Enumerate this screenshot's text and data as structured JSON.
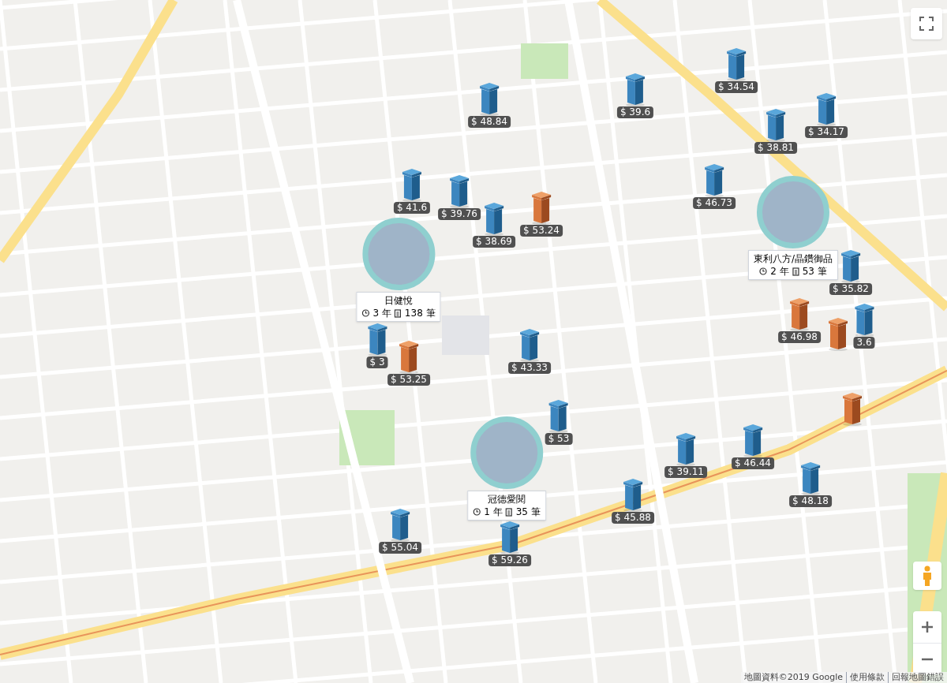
{
  "markers": [
    {
      "kind": "blue",
      "price": "$ 48.84"
    },
    {
      "kind": "blue",
      "price": "$ 39.6"
    },
    {
      "kind": "blue",
      "price": "$ 34.54"
    },
    {
      "kind": "blue",
      "price": "$ 38.81"
    },
    {
      "kind": "blue",
      "price": "$ 34.17"
    },
    {
      "kind": "blue",
      "price": "$ 41.6"
    },
    {
      "kind": "blue",
      "price": "$ 39.76"
    },
    {
      "kind": "blue",
      "price": "$ 38.69"
    },
    {
      "kind": "orange",
      "price": "$ 53.24"
    },
    {
      "kind": "blue",
      "price": "$ 46.73"
    },
    {
      "kind": "blue",
      "price": "$ 35.82"
    },
    {
      "kind": "orange",
      "price": "$ 46.98"
    },
    {
      "kind": "blue",
      "price": "3.6"
    },
    {
      "kind": "blue",
      "price": "$ 3"
    },
    {
      "kind": "orange",
      "price": "$ 53.25"
    },
    {
      "kind": "blue",
      "price": "$ 43.33"
    },
    {
      "kind": "blue",
      "price": "$ 53"
    },
    {
      "kind": "blue",
      "price": "$ 46.44"
    },
    {
      "kind": "blue",
      "price": "$ 39.11"
    },
    {
      "kind": "blue",
      "price": "$ 48.18"
    },
    {
      "kind": "blue",
      "price": "$ 45.88"
    },
    {
      "kind": "blue",
      "price": "$ 55.04"
    },
    {
      "kind": "blue",
      "price": "$ 59.26"
    },
    {
      "kind": "orange"
    },
    {
      "kind": "orange"
    }
  ],
  "projects": [
    {
      "name": "日健悅",
      "years": "3 年",
      "count": "138 筆"
    },
    {
      "name": "東利八方/晶鑽御品",
      "years": "2 年",
      "count": "53 筆"
    },
    {
      "name": "冠德愛閱",
      "years": "1 年",
      "count": "35 筆"
    }
  ],
  "attribution": {
    "data": "地圖資料©2019 Google",
    "terms": "使用條款",
    "report": "回報地圖錯誤"
  }
}
